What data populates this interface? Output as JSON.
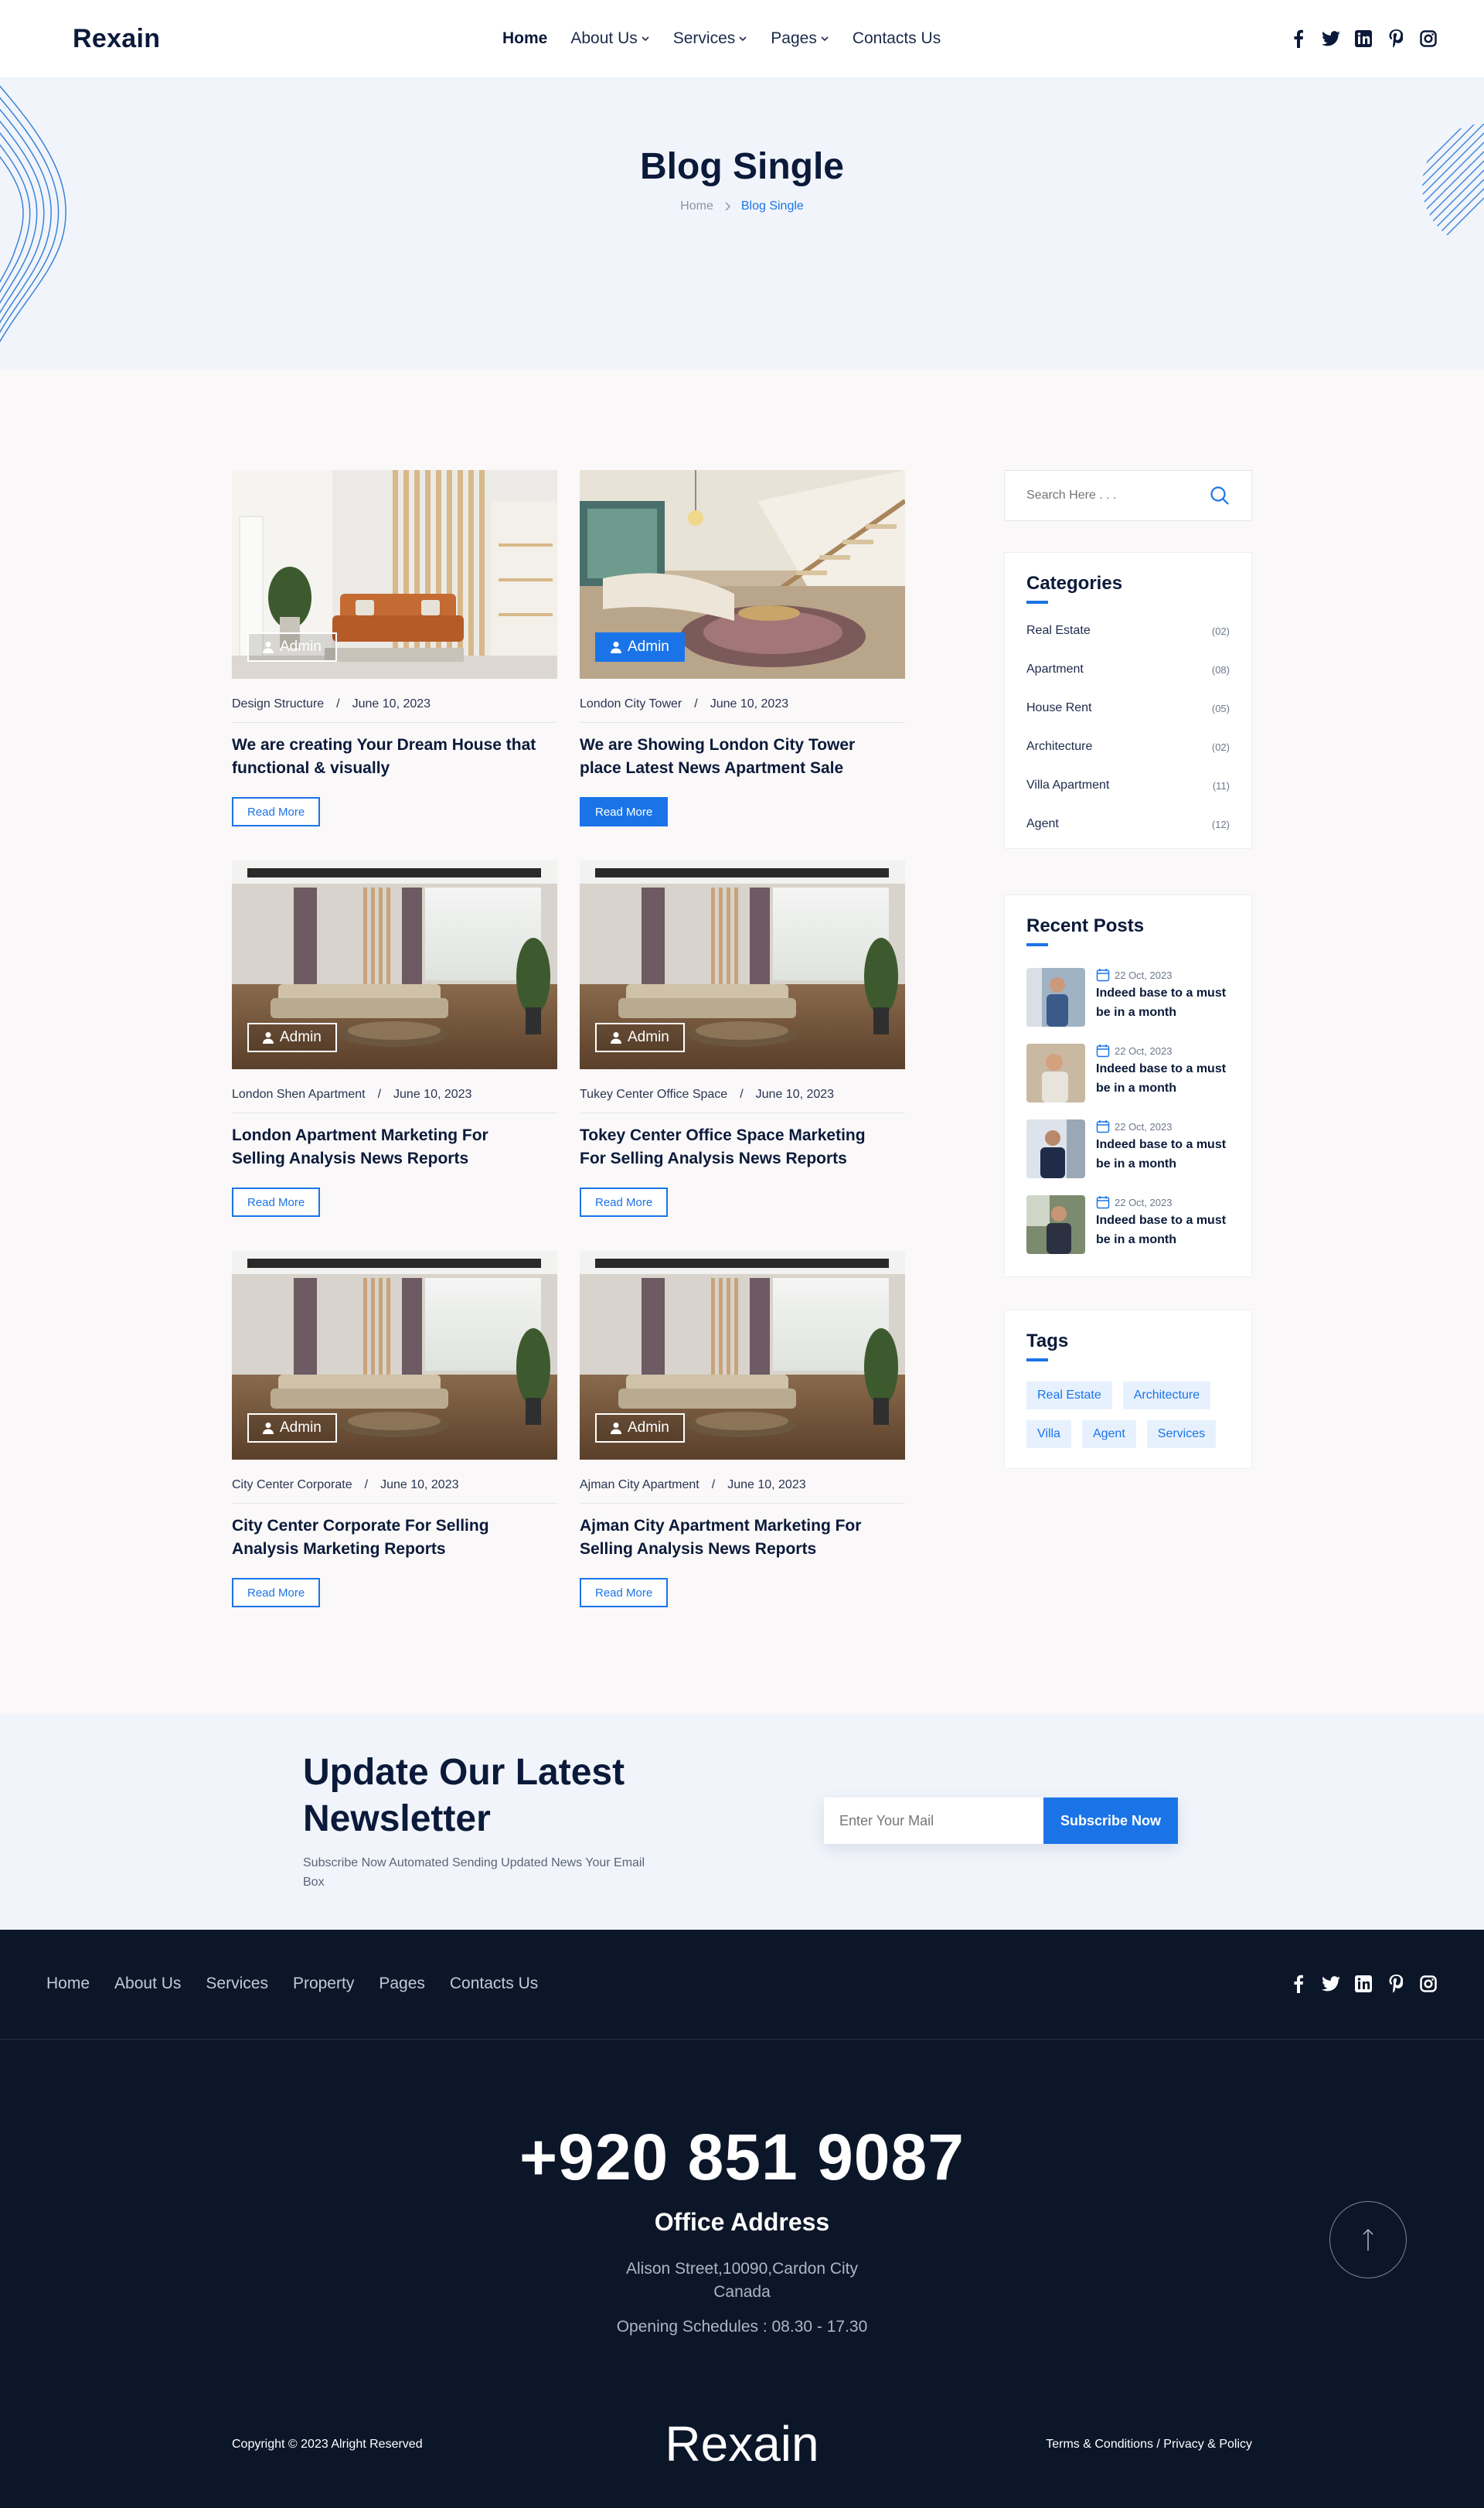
{
  "header": {
    "logo": "Rexain",
    "nav": [
      {
        "label": "Home",
        "active": true,
        "dropdown": false
      },
      {
        "label": "About Us",
        "active": false,
        "dropdown": true
      },
      {
        "label": "Services",
        "active": false,
        "dropdown": true
      },
      {
        "label": "Pages",
        "active": false,
        "dropdown": true
      },
      {
        "label": "Contacts Us",
        "active": false,
        "dropdown": false
      }
    ],
    "social": [
      "facebook-icon",
      "twitter-icon",
      "linkedin-icon",
      "pinterest-icon",
      "instagram-icon"
    ]
  },
  "hero": {
    "title": "Blog Single",
    "breadcrumb_home": "Home",
    "breadcrumb_current": "Blog Single"
  },
  "posts": [
    {
      "author": "Admin",
      "category": "Design Structure",
      "date": "June 10, 2023",
      "title": "We are creating Your Dream House that functional & visually",
      "cta": "Read More"
    },
    {
      "author": "Admin",
      "category": "London City Tower",
      "date": "June 10, 2023",
      "title": "We are Showing London City Tower place Latest News Apartment Sale",
      "cta": "Read More"
    },
    {
      "author": "Admin",
      "category": "London Shen Apartment",
      "date": "June 10, 2023",
      "title": "London Apartment Marketing For Selling Analysis News Reports",
      "cta": "Read More"
    },
    {
      "author": "Admin",
      "category": "Tukey Center Office Space",
      "date": "June 10, 2023",
      "title": "Tokey Center Office Space Marketing For Selling Analysis News Reports",
      "cta": "Read More"
    },
    {
      "author": "Admin",
      "category": "City Center Corporate",
      "date": "June 10, 2023",
      "title": "City Center Corporate For Selling Analysis Marketing Reports",
      "cta": "Read More"
    },
    {
      "author": "Admin",
      "category": "Ajman City Apartment",
      "date": "June 10, 2023",
      "title": "Ajman City Apartment Marketing For Selling Analysis News Reports",
      "cta": "Read More"
    }
  ],
  "sidebar": {
    "search_placeholder": "Search Here . . .",
    "categories_title": "Categories",
    "categories": [
      {
        "name": "Real Estate",
        "count": "(02)"
      },
      {
        "name": "Apartment",
        "count": "(08)"
      },
      {
        "name": "House Rent",
        "count": "(05)"
      },
      {
        "name": "Architecture",
        "count": "(02)"
      },
      {
        "name": "Villa Apartment",
        "count": "(11)"
      },
      {
        "name": "Agent",
        "count": "(12)"
      }
    ],
    "recent_title": "Recent Posts",
    "recent": [
      {
        "date": "22 Oct, 2023",
        "title": "Indeed base to a must  be in a month"
      },
      {
        "date": "22 Oct, 2023",
        "title": "Indeed base to a must  be in a month"
      },
      {
        "date": "22 Oct, 2023",
        "title": "Indeed base to a must  be in a month"
      },
      {
        "date": "22 Oct, 2023",
        "title": "Indeed base to a must  be in a month"
      }
    ],
    "tags_title": "Tags",
    "tags": [
      "Real Estate",
      "Architecture",
      "Villa",
      "Agent",
      "Services"
    ]
  },
  "newsletter": {
    "title": "Update Our Latest Newsletter",
    "text": "Subscribe Now Automated Sending Updated News Your Email Box",
    "placeholder": "Enter Your Mail",
    "button": "Subscribe Now"
  },
  "footer": {
    "links": [
      "Home",
      "About Us",
      "Services",
      "Property",
      "Pages",
      "Contacts Us"
    ],
    "phone": "+920 851 9087",
    "office_title": "Office Address",
    "address": "Alison Street,10090,Cardon City Canada",
    "schedule": "Opening Schedules : 08.30 - 17.30",
    "copyright": "Copyright © 2023 Alright Reserved",
    "logo": "Rexain",
    "terms": "Terms & Conditions / Privacy & Policy"
  },
  "colors": {
    "accent": "#1a74e8",
    "navy": "#0b1a3a",
    "footer_bg": "#0c1629",
    "hero_bg": "#f1f5fb"
  }
}
